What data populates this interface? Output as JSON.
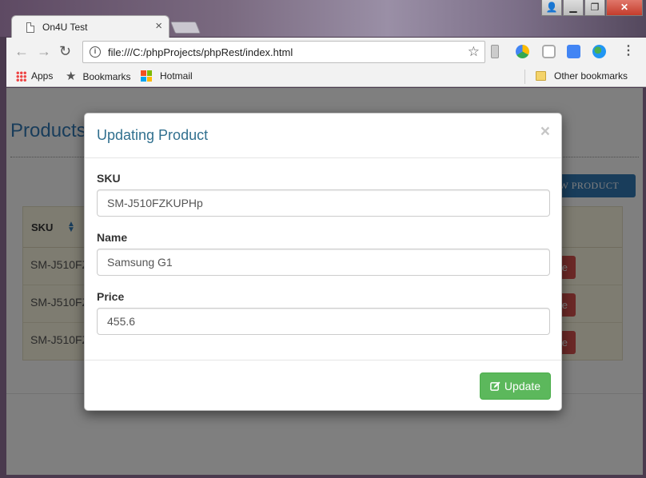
{
  "browser": {
    "tab_title": "On4U Test",
    "tab_close": "×",
    "url": "file:///C:/phpProjects/phpRest/index.html",
    "bookmarks": {
      "apps": "Apps",
      "bookmarks": "Bookmarks",
      "hotmail": "Hotmail",
      "other": "Other bookmarks"
    },
    "window_buttons": {
      "user": "👤",
      "minimize": "▁",
      "maximize": "❐",
      "close": "✕"
    }
  },
  "page": {
    "title": "Products",
    "new_product_label": "EW   PRODUCT",
    "table": {
      "header_sku": "SKU",
      "rows": [
        {
          "sku": "SM-J510FZ",
          "delete": "e"
        },
        {
          "sku": "SM-J510FZ",
          "delete": "e"
        },
        {
          "sku": "SM-J510FZ",
          "delete": "e"
        }
      ]
    }
  },
  "modal": {
    "title": "Updating Product",
    "close": "×",
    "fields": {
      "sku": {
        "label": "SKU",
        "value": "SM-J510FZKUPHp"
      },
      "name": {
        "label": "Name",
        "value": "Samsung G1"
      },
      "price": {
        "label": "Price",
        "value": "455.6"
      }
    },
    "update_label": "Update"
  }
}
